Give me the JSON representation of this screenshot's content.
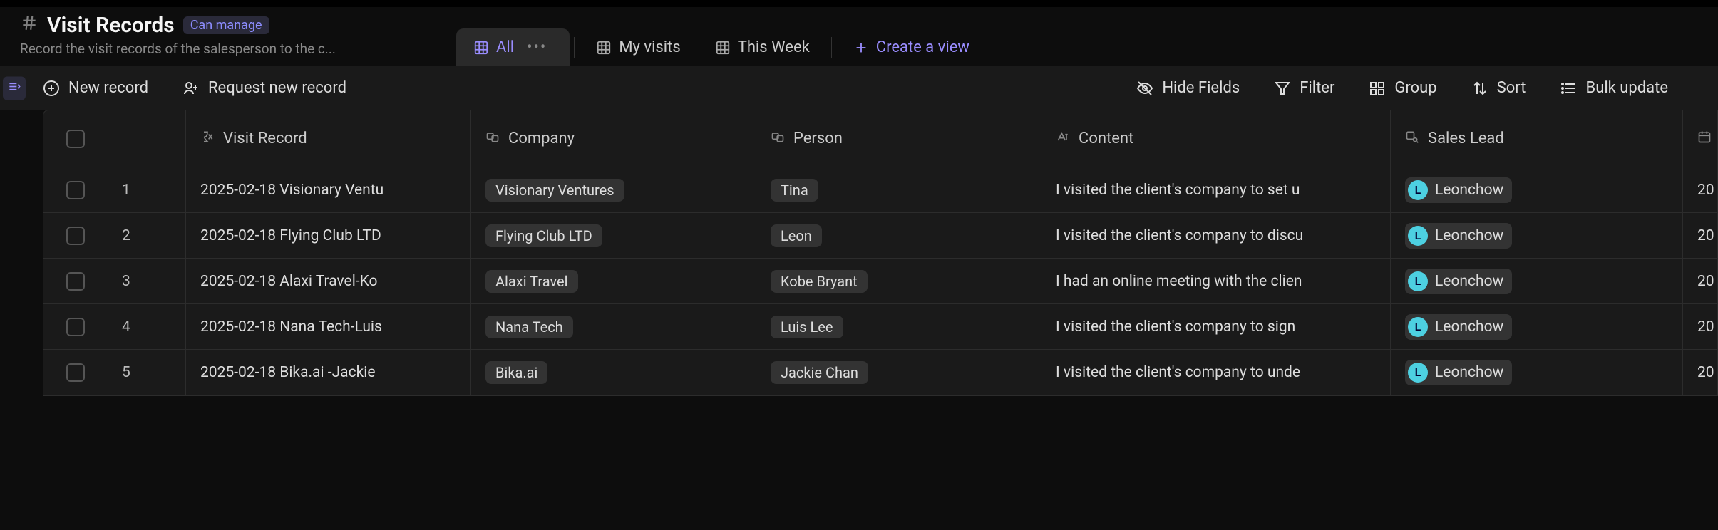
{
  "header": {
    "title": "Visit Records",
    "permission_label": "Can manage",
    "subtitle": "Record the visit records of the salesperson to the c..."
  },
  "views": {
    "active": "All",
    "tabs": [
      "All",
      "My visits",
      "This Week"
    ],
    "create_label": "Create a view"
  },
  "toolbar": {
    "new_record": "New record",
    "request_new": "Request new record",
    "hide_fields": "Hide Fields",
    "filter": "Filter",
    "group": "Group",
    "sort": "Sort",
    "bulk_update": "Bulk update"
  },
  "columns": {
    "visit_record": "Visit Record",
    "company": "Company",
    "person": "Person",
    "content": "Content",
    "sales_lead": "Sales Lead"
  },
  "rows": [
    {
      "idx": "1",
      "record": "2025-02-18 Visionary Ventu",
      "company": "Visionary Ventures",
      "person": "Tina",
      "content": "I visited the client's company to set u",
      "lead": "Leonchow",
      "lead_initial": "L",
      "trail": "20"
    },
    {
      "idx": "2",
      "record": "2025-02-18 Flying Club LTD",
      "company": "Flying Club LTD",
      "person": "Leon",
      "content": "I visited the client's company to discu",
      "lead": "Leonchow",
      "lead_initial": "L",
      "trail": "20"
    },
    {
      "idx": "3",
      "record": "2025-02-18 Alaxi Travel-Ko",
      "company": "Alaxi Travel",
      "person": "Kobe Bryant",
      "content": "I had an online meeting with the clien",
      "lead": "Leonchow",
      "lead_initial": "L",
      "trail": "20"
    },
    {
      "idx": "4",
      "record": "2025-02-18 Nana Tech-Luis",
      "company": "Nana Tech",
      "person": "Luis Lee",
      "content": "I visited the client's company to sign",
      "lead": "Leonchow",
      "lead_initial": "L",
      "trail": "20"
    },
    {
      "idx": "5",
      "record": "2025-02-18 Bika.ai -Jackie",
      "company": "Bika.ai",
      "person": "Jackie Chan",
      "content": "I visited the client's company to unde",
      "lead": "Leonchow",
      "lead_initial": "L",
      "trail": "20"
    }
  ],
  "colors": {
    "accent": "#9a8dff",
    "avatar_bg": "#4dd0e1"
  }
}
